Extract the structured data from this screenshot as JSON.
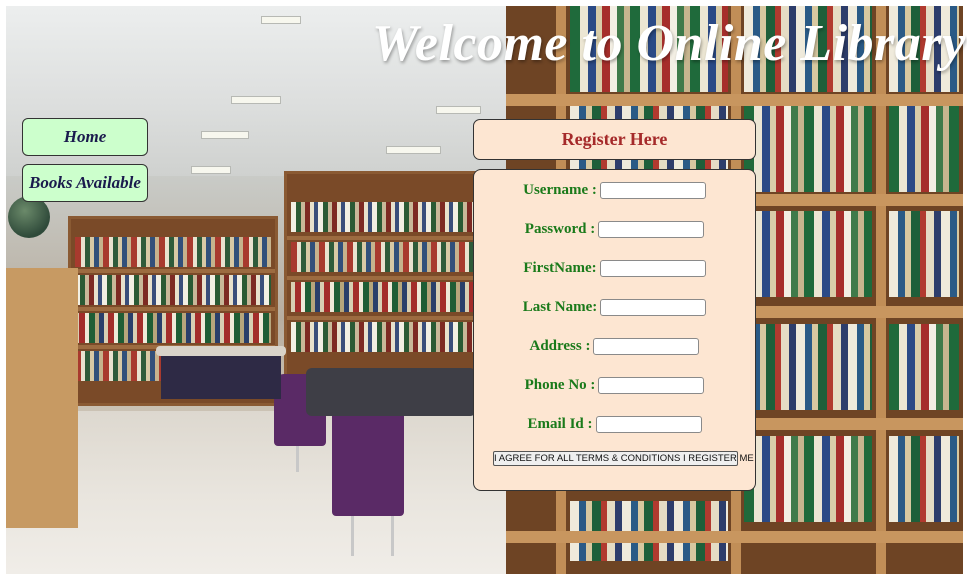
{
  "page": {
    "title": "Welcome to Online Library"
  },
  "nav": {
    "home_label": "Home",
    "books_label": "Books Available"
  },
  "register": {
    "header": "Register Here",
    "fields": [
      {
        "label": "Username :",
        "value": ""
      },
      {
        "label": "Password :",
        "value": ""
      },
      {
        "label": "FirstName:",
        "value": ""
      },
      {
        "label": "Last Name:",
        "value": ""
      },
      {
        "label": "Address :",
        "value": ""
      },
      {
        "label": "Phone No :",
        "value": ""
      },
      {
        "label": "Email Id :",
        "value": ""
      }
    ],
    "submit_label": "I AGREE FOR ALL TERMS & CONDITIONS I REGISTER ME"
  },
  "colors": {
    "nav_button_bg": "#ccffcc",
    "panel_bg": "#fde6d2",
    "header_text": "#a52a2a",
    "label_text": "#1a7a1a",
    "title_text": "#ffffff"
  }
}
